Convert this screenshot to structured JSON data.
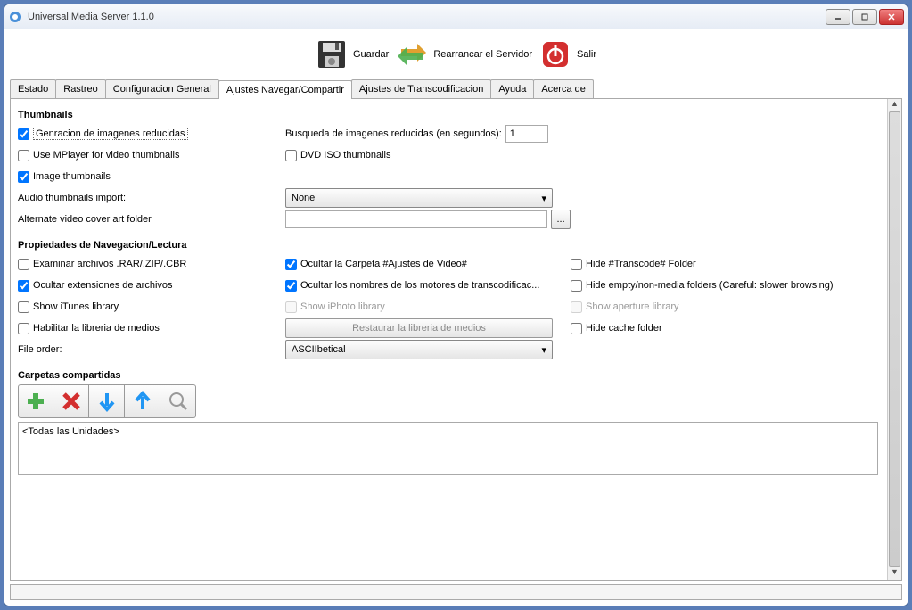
{
  "window": {
    "title": "Universal Media Server 1.1.0"
  },
  "toolbar": {
    "save": "Guardar",
    "restart": "Rearrancar el Servidor",
    "exit": "Salir"
  },
  "tabs": [
    "Estado",
    "Rastreo",
    "Configuracion General",
    "Ajustes Navegar/Compartir",
    "Ajustes de Transcodificacion",
    "Ayuda",
    "Acerca de"
  ],
  "active_tab": 3,
  "thumbnails": {
    "title": "Thumbnails",
    "gen_thumb": "Genracion de imagenes reducidas",
    "search_label": "Busqueda de imagenes reducidas (en segundos):",
    "search_value": "1",
    "use_mplayer": "Use MPlayer for video thumbnails",
    "dvd_iso": "DVD ISO thumbnails",
    "image_thumb": "Image thumbnails",
    "audio_import": "Audio thumbnails import:",
    "audio_import_value": "None",
    "alt_cover": "Alternate video cover art folder",
    "alt_cover_value": ""
  },
  "nav": {
    "title": "Propiedades de Navegacion/Lectura",
    "examine": "Examinar archivos .RAR/.ZIP/.CBR",
    "hide_video_settings": "Ocultar la Carpeta #Ajustes de Video#",
    "hide_transcode": "Hide #Transcode# Folder",
    "hide_ext": "Ocultar extensiones de archivos",
    "hide_engine_names": "Ocultar los nombres de los motores de transcodificac...",
    "hide_empty": "Hide empty/non-media folders (Careful: slower browsing)",
    "show_itunes": "Show iTunes library",
    "show_iphoto": "Show iPhoto library",
    "show_aperture": "Show aperture library",
    "enable_media_lib": "Habilitar la libreria de medios",
    "restore_media_lib": "Restaurar la libreria de medios",
    "hide_cache": "Hide cache folder",
    "file_order": "File order:",
    "file_order_value": "ASCIIbetical"
  },
  "shared": {
    "title": "Carpetas compartidas",
    "list_text": "<Todas las Unidades>"
  }
}
